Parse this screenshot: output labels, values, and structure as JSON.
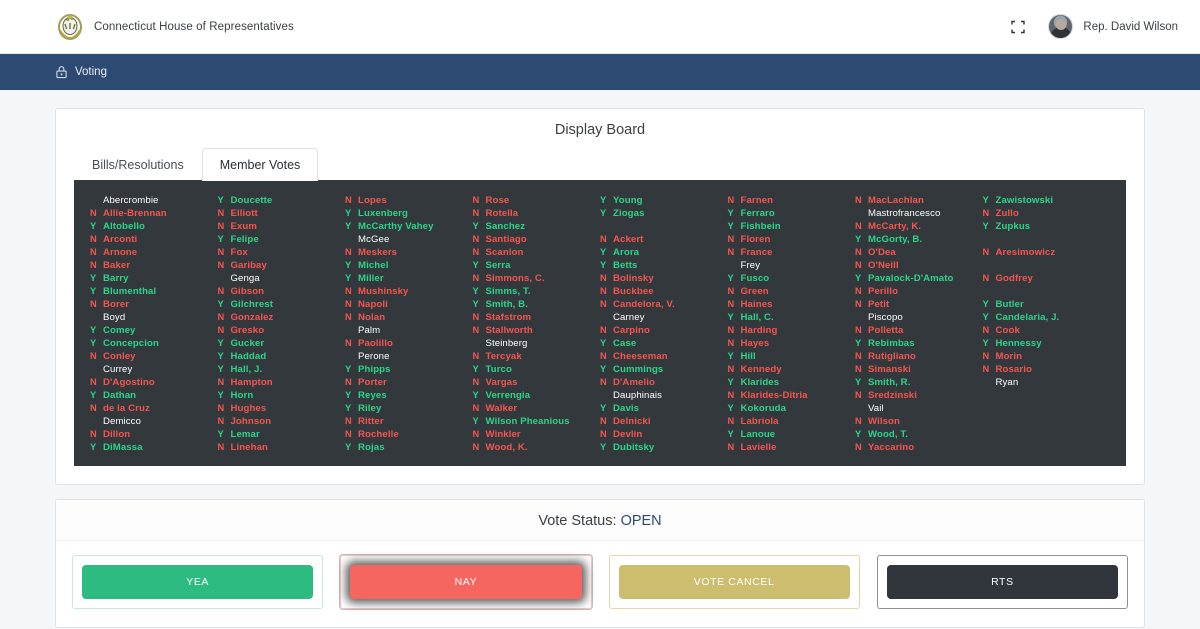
{
  "header": {
    "brand_name": "Connecticut House of Representatives",
    "seal_icon": "state-seal-icon",
    "expand_icon": "expand-fullscreen-icon",
    "avatar_icon": "user-avatar",
    "user_name": "Rep. David Wilson"
  },
  "nav": {
    "icon": "ballot-box-icon",
    "label": "Voting"
  },
  "display_board": {
    "title": "Display Board",
    "tabs": [
      {
        "label": "Bills/Resolutions",
        "active": false
      },
      {
        "label": "Member Votes",
        "active": true
      }
    ],
    "columns": [
      [
        {
          "vote": "",
          "name": "Abercrombie"
        },
        {
          "vote": "N",
          "name": "Allie-Brennan"
        },
        {
          "vote": "Y",
          "name": "Altobello"
        },
        {
          "vote": "N",
          "name": "Arconti"
        },
        {
          "vote": "N",
          "name": "Arnone"
        },
        {
          "vote": "N",
          "name": "Baker"
        },
        {
          "vote": "Y",
          "name": "Barry"
        },
        {
          "vote": "Y",
          "name": "Blumenthal"
        },
        {
          "vote": "N",
          "name": "Borer"
        },
        {
          "vote": "",
          "name": "Boyd"
        },
        {
          "vote": "Y",
          "name": "Comey"
        },
        {
          "vote": "Y",
          "name": "Concepcion"
        },
        {
          "vote": "N",
          "name": "Conley"
        },
        {
          "vote": "",
          "name": "Currey"
        },
        {
          "vote": "N",
          "name": "D'Agostino"
        },
        {
          "vote": "Y",
          "name": "Dathan"
        },
        {
          "vote": "N",
          "name": "de la Cruz"
        },
        {
          "vote": "",
          "name": "Demicco"
        },
        {
          "vote": "N",
          "name": "Dillon"
        },
        {
          "vote": "Y",
          "name": "DiMassa"
        }
      ],
      [
        {
          "vote": "Y",
          "name": "Doucette"
        },
        {
          "vote": "N",
          "name": "Elliott"
        },
        {
          "vote": "N",
          "name": "Exum"
        },
        {
          "vote": "Y",
          "name": "Felipe"
        },
        {
          "vote": "N",
          "name": "Fox"
        },
        {
          "vote": "N",
          "name": "Garibay"
        },
        {
          "vote": "",
          "name": "Genga"
        },
        {
          "vote": "N",
          "name": "Gibson"
        },
        {
          "vote": "Y",
          "name": "Gilchrest"
        },
        {
          "vote": "N",
          "name": "Gonzalez"
        },
        {
          "vote": "N",
          "name": "Gresko"
        },
        {
          "vote": "Y",
          "name": "Gucker"
        },
        {
          "vote": "Y",
          "name": "Haddad"
        },
        {
          "vote": "Y",
          "name": "Hall, J."
        },
        {
          "vote": "N",
          "name": "Hampton"
        },
        {
          "vote": "Y",
          "name": "Horn"
        },
        {
          "vote": "N",
          "name": "Hughes"
        },
        {
          "vote": "N",
          "name": "Johnson"
        },
        {
          "vote": "Y",
          "name": "Lemar"
        },
        {
          "vote": "N",
          "name": "Linehan"
        }
      ],
      [
        {
          "vote": "N",
          "name": "Lopes"
        },
        {
          "vote": "Y",
          "name": "Luxenberg"
        },
        {
          "vote": "Y",
          "name": "McCarthy Vahey"
        },
        {
          "vote": "",
          "name": "McGee"
        },
        {
          "vote": "N",
          "name": "Meskers"
        },
        {
          "vote": "Y",
          "name": "Michel"
        },
        {
          "vote": "Y",
          "name": "Miller"
        },
        {
          "vote": "N",
          "name": "Mushinsky"
        },
        {
          "vote": "N",
          "name": "Napoli"
        },
        {
          "vote": "N",
          "name": "Nolan"
        },
        {
          "vote": "",
          "name": "Palm"
        },
        {
          "vote": "N",
          "name": "Paolillo"
        },
        {
          "vote": "",
          "name": "Perone"
        },
        {
          "vote": "Y",
          "name": "Phipps"
        },
        {
          "vote": "N",
          "name": "Porter"
        },
        {
          "vote": "Y",
          "name": "Reyes"
        },
        {
          "vote": "Y",
          "name": "Riley"
        },
        {
          "vote": "N",
          "name": "Ritter"
        },
        {
          "vote": "N",
          "name": "Rochelle"
        },
        {
          "vote": "Y",
          "name": "Rojas"
        }
      ],
      [
        {
          "vote": "N",
          "name": "Rose"
        },
        {
          "vote": "N",
          "name": "Rotella"
        },
        {
          "vote": "Y",
          "name": "Sanchez"
        },
        {
          "vote": "N",
          "name": "Santiago"
        },
        {
          "vote": "N",
          "name": "Scanlon"
        },
        {
          "vote": "Y",
          "name": "Serra"
        },
        {
          "vote": "N",
          "name": "Simmons, C."
        },
        {
          "vote": "Y",
          "name": "Simms, T."
        },
        {
          "vote": "Y",
          "name": "Smith, B."
        },
        {
          "vote": "N",
          "name": "Stafstrom"
        },
        {
          "vote": "N",
          "name": "Stallworth"
        },
        {
          "vote": "",
          "name": "Steinberg"
        },
        {
          "vote": "N",
          "name": "Tercyak"
        },
        {
          "vote": "Y",
          "name": "Turco"
        },
        {
          "vote": "N",
          "name": "Vargas"
        },
        {
          "vote": "Y",
          "name": "Verrengia"
        },
        {
          "vote": "N",
          "name": "Walker"
        },
        {
          "vote": "Y",
          "name": "Wilson Pheanious"
        },
        {
          "vote": "N",
          "name": "Winkler"
        },
        {
          "vote": "N",
          "name": "Wood, K."
        }
      ],
      [
        {
          "vote": "Y",
          "name": "Young"
        },
        {
          "vote": "Y",
          "name": "Ziogas"
        },
        {
          "vote": "",
          "name": "",
          "spacer": true
        },
        {
          "vote": "N",
          "name": "Ackert"
        },
        {
          "vote": "Y",
          "name": "Arora"
        },
        {
          "vote": "Y",
          "name": "Betts"
        },
        {
          "vote": "N",
          "name": "Bolinsky"
        },
        {
          "vote": "N",
          "name": "Buckbee"
        },
        {
          "vote": "N",
          "name": "Candelora, V."
        },
        {
          "vote": "",
          "name": "Carney"
        },
        {
          "vote": "N",
          "name": "Carpino"
        },
        {
          "vote": "Y",
          "name": "Case"
        },
        {
          "vote": "N",
          "name": "Cheeseman"
        },
        {
          "vote": "Y",
          "name": "Cummings"
        },
        {
          "vote": "N",
          "name": "D'Amelio"
        },
        {
          "vote": "",
          "name": "Dauphinais"
        },
        {
          "vote": "Y",
          "name": "Davis"
        },
        {
          "vote": "N",
          "name": "Delnicki"
        },
        {
          "vote": "N",
          "name": "Devlin"
        },
        {
          "vote": "Y",
          "name": "Dubitsky"
        }
      ],
      [
        {
          "vote": "N",
          "name": "Farnen"
        },
        {
          "vote": "Y",
          "name": "Ferraro"
        },
        {
          "vote": "Y",
          "name": "Fishbein"
        },
        {
          "vote": "N",
          "name": "Floren"
        },
        {
          "vote": "N",
          "name": "France"
        },
        {
          "vote": "",
          "name": "Frey"
        },
        {
          "vote": "Y",
          "name": "Fusco"
        },
        {
          "vote": "N",
          "name": "Green"
        },
        {
          "vote": "N",
          "name": "Haines"
        },
        {
          "vote": "Y",
          "name": "Hall, C."
        },
        {
          "vote": "N",
          "name": "Harding"
        },
        {
          "vote": "N",
          "name": "Hayes"
        },
        {
          "vote": "Y",
          "name": "Hill"
        },
        {
          "vote": "N",
          "name": "Kennedy"
        },
        {
          "vote": "Y",
          "name": "Klarides"
        },
        {
          "vote": "N",
          "name": "Klarides-Ditria"
        },
        {
          "vote": "Y",
          "name": "Kokoruda"
        },
        {
          "vote": "N",
          "name": "Labriola"
        },
        {
          "vote": "Y",
          "name": "Lanoue"
        },
        {
          "vote": "N",
          "name": "Lavielle"
        }
      ],
      [
        {
          "vote": "N",
          "name": "MacLachlan"
        },
        {
          "vote": "",
          "name": "Mastrofrancesco"
        },
        {
          "vote": "N",
          "name": "McCarty, K."
        },
        {
          "vote": "Y",
          "name": "McGorty, B."
        },
        {
          "vote": "N",
          "name": "O'Dea"
        },
        {
          "vote": "N",
          "name": "O'Neill"
        },
        {
          "vote": "Y",
          "name": "Pavalock-D'Amato"
        },
        {
          "vote": "N",
          "name": "Perillo"
        },
        {
          "vote": "N",
          "name": "Petit"
        },
        {
          "vote": "",
          "name": "Piscopo"
        },
        {
          "vote": "N",
          "name": "Polletta"
        },
        {
          "vote": "Y",
          "name": "Rebimbas"
        },
        {
          "vote": "N",
          "name": "Rutigliano"
        },
        {
          "vote": "N",
          "name": "Simanski"
        },
        {
          "vote": "Y",
          "name": "Smith, R."
        },
        {
          "vote": "N",
          "name": "Sredzinski"
        },
        {
          "vote": "",
          "name": "Vail"
        },
        {
          "vote": "N",
          "name": "Wilson"
        },
        {
          "vote": "Y",
          "name": "Wood, T."
        },
        {
          "vote": "N",
          "name": "Yaccarino"
        }
      ],
      [
        {
          "vote": "Y",
          "name": "Zawistowski"
        },
        {
          "vote": "N",
          "name": "Zullo"
        },
        {
          "vote": "Y",
          "name": "Zupkus"
        },
        {
          "vote": "",
          "name": "",
          "spacer": true
        },
        {
          "vote": "N",
          "name": "Aresimowicz"
        },
        {
          "vote": "",
          "name": "",
          "spacer": true
        },
        {
          "vote": "N",
          "name": "Godfrey"
        },
        {
          "vote": "",
          "name": "",
          "spacer": true
        },
        {
          "vote": "Y",
          "name": "Butler"
        },
        {
          "vote": "Y",
          "name": "Candelaria, J."
        },
        {
          "vote": "N",
          "name": "Cook"
        },
        {
          "vote": "Y",
          "name": "Hennessy"
        },
        {
          "vote": "N",
          "name": "Morin"
        },
        {
          "vote": "N",
          "name": "Rosario"
        },
        {
          "vote": "",
          "name": "Ryan"
        }
      ]
    ]
  },
  "vote_status": {
    "label": "Vote Status:",
    "value": "OPEN",
    "buttons": [
      {
        "label": "YEA",
        "key": "yea"
      },
      {
        "label": "NAY",
        "key": "nay"
      },
      {
        "label": "VOTE CANCEL",
        "key": "cancel"
      },
      {
        "label": "RTS",
        "key": "rts"
      }
    ]
  },
  "colors": {
    "nav_blue": "#2d4a73",
    "board_bg": "#33383d",
    "yea_green": "#2ebb82",
    "nay_red": "#f4665f",
    "cancel_gold": "#cdbd6e",
    "rts_dark": "#31363c",
    "vote_yes_text": "#2dd48a",
    "vote_no_text": "#f4564f",
    "status_open": "#2d4a73"
  }
}
